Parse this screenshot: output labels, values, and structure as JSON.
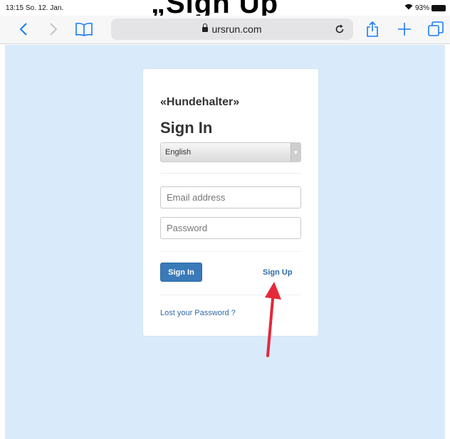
{
  "caption": "„Sign Up",
  "status": {
    "time": "13:15",
    "date": "So. 12. Jan.",
    "battery": "93%"
  },
  "browser": {
    "url": "ursrun.com"
  },
  "card": {
    "brand": "«Hundehalter»",
    "title": "Sign In",
    "language": "English",
    "email_placeholder": "Email address",
    "password_placeholder": "Password",
    "signin_label": "Sign In",
    "signup_label": "Sign Up",
    "lost_password_label": "Lost your Password ?"
  },
  "colors": {
    "page_bg": "#d9ebfb",
    "primary": "#3a7ab8",
    "link": "#2f6aa8",
    "arrow": "#e5283a",
    "ios_blue": "#1a7cf5"
  },
  "icons": [
    "back-icon",
    "forward-icon",
    "bookmarks-icon",
    "lock-icon",
    "reload-icon",
    "share-icon",
    "new-tab-icon",
    "tabs-icon",
    "wifi-icon",
    "battery-icon"
  ]
}
